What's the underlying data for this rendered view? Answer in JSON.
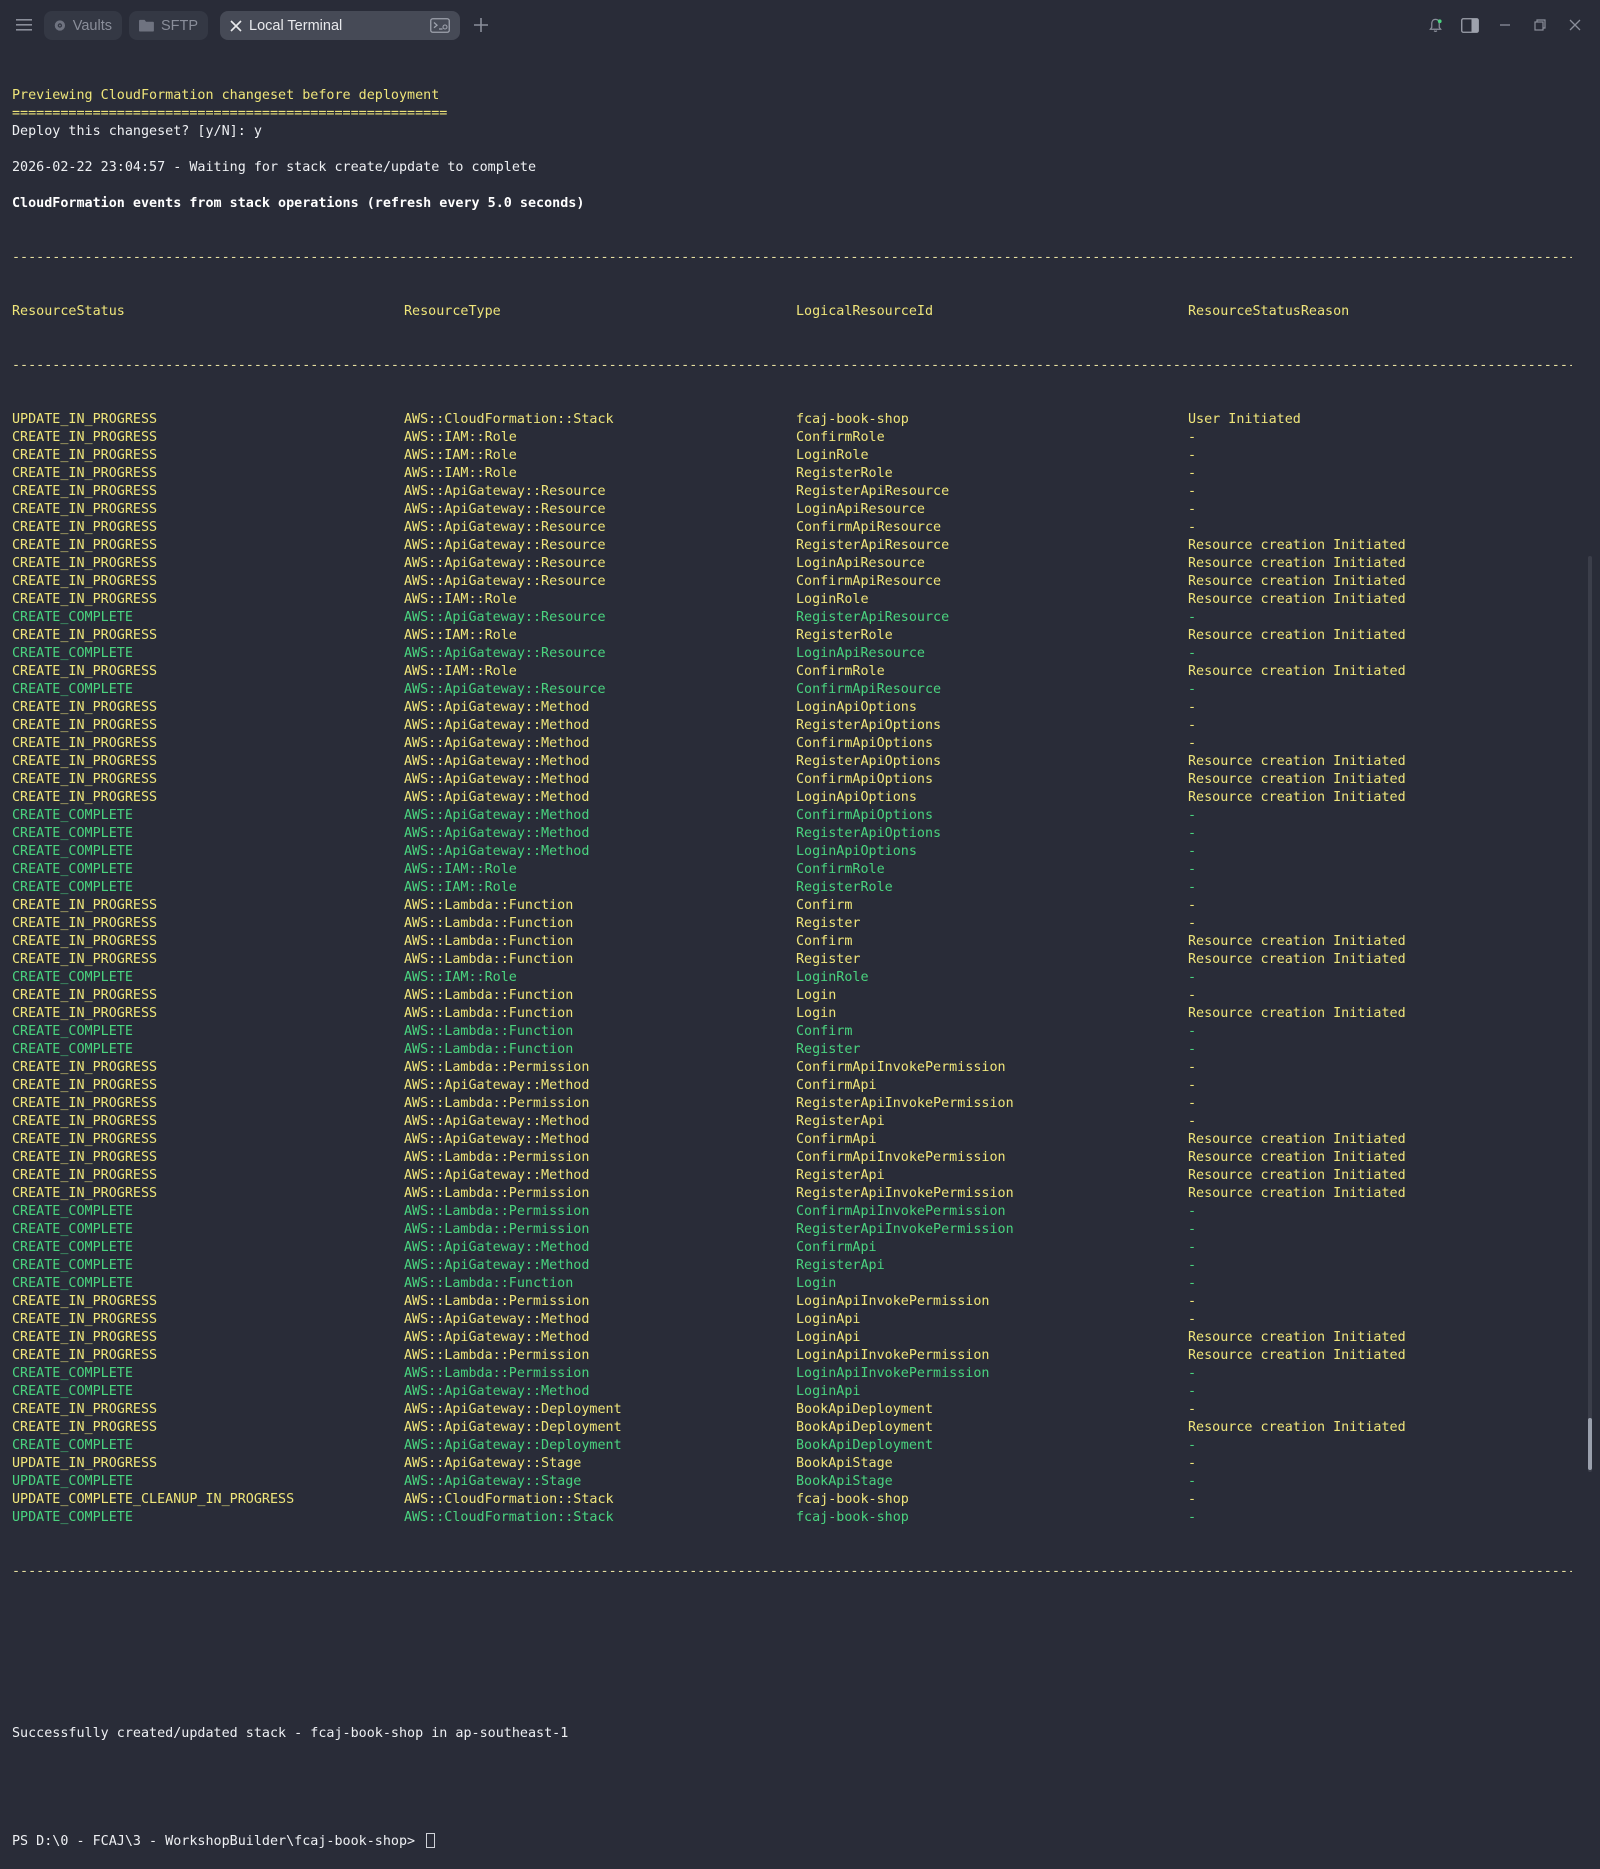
{
  "tabs": [
    {
      "label": "Vaults",
      "icon": "vault-icon"
    },
    {
      "label": "SFTP",
      "icon": "folder-icon"
    },
    {
      "label": "Local Terminal",
      "icon": "close-icon",
      "active": true
    }
  ],
  "terminal": {
    "lines": [
      {
        "text": "Previewing CloudFormation changeset before deployment",
        "style": "y"
      },
      {
        "text": "======================================================",
        "style": "y"
      },
      {
        "text": "Deploy this changeset? [y/N]: y",
        "style": "w"
      },
      {
        "text": "",
        "style": "w"
      },
      {
        "text": "2026-02-22 23:04:57 - Waiting for stack create/update to complete",
        "style": "w"
      },
      {
        "text": "",
        "style": "w"
      },
      {
        "text": "CloudFormation events from stack operations (refresh every 5.0 seconds)",
        "style": "wb"
      }
    ],
    "table_headers": [
      "ResourceStatus",
      "ResourceType",
      "LogicalResourceId",
      "ResourceStatusReason"
    ],
    "events": [
      [
        "UPDATE_IN_PROGRESS",
        "AWS::CloudFormation::Stack",
        "fcaj-book-shop",
        "User Initiated"
      ],
      [
        "CREATE_IN_PROGRESS",
        "AWS::IAM::Role",
        "ConfirmRole",
        "-"
      ],
      [
        "CREATE_IN_PROGRESS",
        "AWS::IAM::Role",
        "LoginRole",
        "-"
      ],
      [
        "CREATE_IN_PROGRESS",
        "AWS::IAM::Role",
        "RegisterRole",
        "-"
      ],
      [
        "CREATE_IN_PROGRESS",
        "AWS::ApiGateway::Resource",
        "RegisterApiResource",
        "-"
      ],
      [
        "CREATE_IN_PROGRESS",
        "AWS::ApiGateway::Resource",
        "LoginApiResource",
        "-"
      ],
      [
        "CREATE_IN_PROGRESS",
        "AWS::ApiGateway::Resource",
        "ConfirmApiResource",
        "-"
      ],
      [
        "CREATE_IN_PROGRESS",
        "AWS::ApiGateway::Resource",
        "RegisterApiResource",
        "Resource creation Initiated"
      ],
      [
        "CREATE_IN_PROGRESS",
        "AWS::ApiGateway::Resource",
        "LoginApiResource",
        "Resource creation Initiated"
      ],
      [
        "CREATE_IN_PROGRESS",
        "AWS::ApiGateway::Resource",
        "ConfirmApiResource",
        "Resource creation Initiated"
      ],
      [
        "CREATE_IN_PROGRESS",
        "AWS::IAM::Role",
        "LoginRole",
        "Resource creation Initiated"
      ],
      [
        "CREATE_COMPLETE",
        "AWS::ApiGateway::Resource",
        "RegisterApiResource",
        "-"
      ],
      [
        "CREATE_IN_PROGRESS",
        "AWS::IAM::Role",
        "RegisterRole",
        "Resource creation Initiated"
      ],
      [
        "CREATE_COMPLETE",
        "AWS::ApiGateway::Resource",
        "LoginApiResource",
        "-"
      ],
      [
        "CREATE_IN_PROGRESS",
        "AWS::IAM::Role",
        "ConfirmRole",
        "Resource creation Initiated"
      ],
      [
        "CREATE_COMPLETE",
        "AWS::ApiGateway::Resource",
        "ConfirmApiResource",
        "-"
      ],
      [
        "CREATE_IN_PROGRESS",
        "AWS::ApiGateway::Method",
        "LoginApiOptions",
        "-"
      ],
      [
        "CREATE_IN_PROGRESS",
        "AWS::ApiGateway::Method",
        "RegisterApiOptions",
        "-"
      ],
      [
        "CREATE_IN_PROGRESS",
        "AWS::ApiGateway::Method",
        "ConfirmApiOptions",
        "-"
      ],
      [
        "CREATE_IN_PROGRESS",
        "AWS::ApiGateway::Method",
        "RegisterApiOptions",
        "Resource creation Initiated"
      ],
      [
        "CREATE_IN_PROGRESS",
        "AWS::ApiGateway::Method",
        "ConfirmApiOptions",
        "Resource creation Initiated"
      ],
      [
        "CREATE_IN_PROGRESS",
        "AWS::ApiGateway::Method",
        "LoginApiOptions",
        "Resource creation Initiated"
      ],
      [
        "CREATE_COMPLETE",
        "AWS::ApiGateway::Method",
        "ConfirmApiOptions",
        "-"
      ],
      [
        "CREATE_COMPLETE",
        "AWS::ApiGateway::Method",
        "RegisterApiOptions",
        "-"
      ],
      [
        "CREATE_COMPLETE",
        "AWS::ApiGateway::Method",
        "LoginApiOptions",
        "-"
      ],
      [
        "CREATE_COMPLETE",
        "AWS::IAM::Role",
        "ConfirmRole",
        "-"
      ],
      [
        "CREATE_COMPLETE",
        "AWS::IAM::Role",
        "RegisterRole",
        "-"
      ],
      [
        "CREATE_IN_PROGRESS",
        "AWS::Lambda::Function",
        "Confirm",
        "-"
      ],
      [
        "CREATE_IN_PROGRESS",
        "AWS::Lambda::Function",
        "Register",
        "-"
      ],
      [
        "CREATE_IN_PROGRESS",
        "AWS::Lambda::Function",
        "Confirm",
        "Resource creation Initiated"
      ],
      [
        "CREATE_IN_PROGRESS",
        "AWS::Lambda::Function",
        "Register",
        "Resource creation Initiated"
      ],
      [
        "CREATE_COMPLETE",
        "AWS::IAM::Role",
        "LoginRole",
        "-"
      ],
      [
        "CREATE_IN_PROGRESS",
        "AWS::Lambda::Function",
        "Login",
        "-"
      ],
      [
        "CREATE_IN_PROGRESS",
        "AWS::Lambda::Function",
        "Login",
        "Resource creation Initiated"
      ],
      [
        "CREATE_COMPLETE",
        "AWS::Lambda::Function",
        "Confirm",
        "-"
      ],
      [
        "CREATE_COMPLETE",
        "AWS::Lambda::Function",
        "Register",
        "-"
      ],
      [
        "CREATE_IN_PROGRESS",
        "AWS::Lambda::Permission",
        "ConfirmApiInvokePermission",
        "-"
      ],
      [
        "CREATE_IN_PROGRESS",
        "AWS::ApiGateway::Method",
        "ConfirmApi",
        "-"
      ],
      [
        "CREATE_IN_PROGRESS",
        "AWS::Lambda::Permission",
        "RegisterApiInvokePermission",
        "-"
      ],
      [
        "CREATE_IN_PROGRESS",
        "AWS::ApiGateway::Method",
        "RegisterApi",
        "-"
      ],
      [
        "CREATE_IN_PROGRESS",
        "AWS::ApiGateway::Method",
        "ConfirmApi",
        "Resource creation Initiated"
      ],
      [
        "CREATE_IN_PROGRESS",
        "AWS::Lambda::Permission",
        "ConfirmApiInvokePermission",
        "Resource creation Initiated"
      ],
      [
        "CREATE_IN_PROGRESS",
        "AWS::ApiGateway::Method",
        "RegisterApi",
        "Resource creation Initiated"
      ],
      [
        "CREATE_IN_PROGRESS",
        "AWS::Lambda::Permission",
        "RegisterApiInvokePermission",
        "Resource creation Initiated"
      ],
      [
        "CREATE_COMPLETE",
        "AWS::Lambda::Permission",
        "ConfirmApiInvokePermission",
        "-"
      ],
      [
        "CREATE_COMPLETE",
        "AWS::Lambda::Permission",
        "RegisterApiInvokePermission",
        "-"
      ],
      [
        "CREATE_COMPLETE",
        "AWS::ApiGateway::Method",
        "ConfirmApi",
        "-"
      ],
      [
        "CREATE_COMPLETE",
        "AWS::ApiGateway::Method",
        "RegisterApi",
        "-"
      ],
      [
        "CREATE_COMPLETE",
        "AWS::Lambda::Function",
        "Login",
        "-"
      ],
      [
        "CREATE_IN_PROGRESS",
        "AWS::Lambda::Permission",
        "LoginApiInvokePermission",
        "-"
      ],
      [
        "CREATE_IN_PROGRESS",
        "AWS::ApiGateway::Method",
        "LoginApi",
        "-"
      ],
      [
        "CREATE_IN_PROGRESS",
        "AWS::ApiGateway::Method",
        "LoginApi",
        "Resource creation Initiated"
      ],
      [
        "CREATE_IN_PROGRESS",
        "AWS::Lambda::Permission",
        "LoginApiInvokePermission",
        "Resource creation Initiated"
      ],
      [
        "CREATE_COMPLETE",
        "AWS::Lambda::Permission",
        "LoginApiInvokePermission",
        "-"
      ],
      [
        "CREATE_COMPLETE",
        "AWS::ApiGateway::Method",
        "LoginApi",
        "-"
      ],
      [
        "CREATE_IN_PROGRESS",
        "AWS::ApiGateway::Deployment",
        "BookApiDeployment",
        "-"
      ],
      [
        "CREATE_IN_PROGRESS",
        "AWS::ApiGateway::Deployment",
        "BookApiDeployment",
        "Resource creation Initiated"
      ],
      [
        "CREATE_COMPLETE",
        "AWS::ApiGateway::Deployment",
        "BookApiDeployment",
        "-"
      ],
      [
        "UPDATE_IN_PROGRESS",
        "AWS::ApiGateway::Stage",
        "BookApiStage",
        "-"
      ],
      [
        "UPDATE_COMPLETE",
        "AWS::ApiGateway::Stage",
        "BookApiStage",
        "-"
      ],
      [
        "UPDATE_COMPLETE_CLEANUP_IN_PROGRESS",
        "AWS::CloudFormation::Stack",
        "fcaj-book-shop",
        "-"
      ],
      [
        "UPDATE_COMPLETE",
        "AWS::CloudFormation::Stack",
        "fcaj-book-shop",
        "-"
      ]
    ],
    "success_message": "Successfully created/updated stack - fcaj-book-shop in ap-southeast-1",
    "prompt": "PS D:\\0 - FCAJ\\3 - WorkshopBuilder\\fcaj-book-shop> "
  },
  "colors": {
    "background": "#292c38",
    "in_progress": "#efe57a",
    "complete": "#4ad37f",
    "text": "#eef0f3"
  }
}
